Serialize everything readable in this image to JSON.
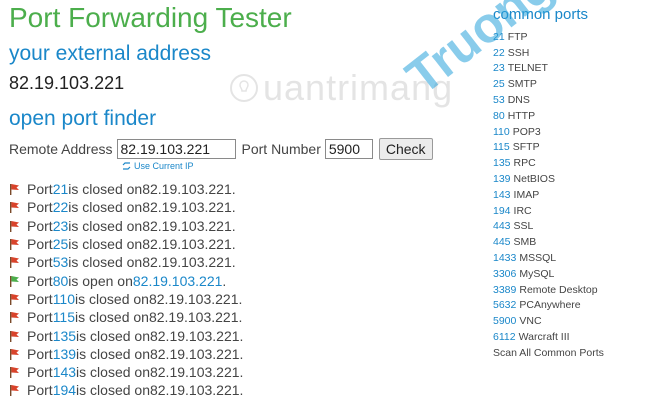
{
  "title": "Port Forwarding Tester",
  "external_heading": "your external address",
  "external_ip": "82.19.103.221",
  "finder_heading": "open port finder",
  "form": {
    "remote_label": "Remote Address",
    "remote_value": "82.19.103.221",
    "port_label": "Port Number",
    "port_value": "5900",
    "check_label": "Check",
    "use_current": "Use Current IP"
  },
  "results": [
    {
      "status": "closed",
      "pre": "Port ",
      "port": "21",
      "mid": " is closed on ",
      "ip": "82.19.103.221",
      "post": "."
    },
    {
      "status": "closed",
      "pre": "Port ",
      "port": "22",
      "mid": " is closed on ",
      "ip": "82.19.103.221",
      "post": "."
    },
    {
      "status": "closed",
      "pre": "Port ",
      "port": "23",
      "mid": " is closed on ",
      "ip": "82.19.103.221",
      "post": "."
    },
    {
      "status": "closed",
      "pre": "Port ",
      "port": "25",
      "mid": " is closed on ",
      "ip": "82.19.103.221",
      "post": "."
    },
    {
      "status": "closed",
      "pre": "Port ",
      "port": "53",
      "mid": " is closed on ",
      "ip": "82.19.103.221",
      "post": "."
    },
    {
      "status": "open",
      "pre": "Port ",
      "port": "80",
      "mid": " is open on ",
      "ip": "82.19.103.221",
      "post": "."
    },
    {
      "status": "closed",
      "pre": "Port ",
      "port": "110",
      "mid": " is closed on ",
      "ip": "82.19.103.221",
      "post": "."
    },
    {
      "status": "closed",
      "pre": "Port ",
      "port": "115",
      "mid": " is closed on ",
      "ip": "82.19.103.221",
      "post": "."
    },
    {
      "status": "closed",
      "pre": "Port ",
      "port": "135",
      "mid": " is closed on ",
      "ip": "82.19.103.221",
      "post": "."
    },
    {
      "status": "closed",
      "pre": "Port ",
      "port": "139",
      "mid": " is closed on ",
      "ip": "82.19.103.221",
      "post": "."
    },
    {
      "status": "closed",
      "pre": "Port ",
      "port": "143",
      "mid": " is closed on ",
      "ip": "82.19.103.221",
      "post": "."
    },
    {
      "status": "closed",
      "pre": "Port ",
      "port": "194",
      "mid": " is closed on ",
      "ip": "82.19.103.221",
      "post": "."
    }
  ],
  "sidebar": {
    "heading": "common ports",
    "ports": [
      {
        "num": "21",
        "name": "FTP"
      },
      {
        "num": "22",
        "name": "SSH"
      },
      {
        "num": "23",
        "name": "TELNET"
      },
      {
        "num": "25",
        "name": "SMTP"
      },
      {
        "num": "53",
        "name": "DNS"
      },
      {
        "num": "80",
        "name": "HTTP"
      },
      {
        "num": "110",
        "name": "POP3"
      },
      {
        "num": "115",
        "name": "SFTP"
      },
      {
        "num": "135",
        "name": "RPC"
      },
      {
        "num": "139",
        "name": "NetBIOS"
      },
      {
        "num": "143",
        "name": "IMAP"
      },
      {
        "num": "194",
        "name": "IRC"
      },
      {
        "num": "443",
        "name": "SSL"
      },
      {
        "num": "445",
        "name": "SMB"
      },
      {
        "num": "1433",
        "name": "MSSQL"
      },
      {
        "num": "3306",
        "name": "MySQL"
      },
      {
        "num": "3389",
        "name": "Remote Desktop"
      },
      {
        "num": "5632",
        "name": "PCAnywhere"
      },
      {
        "num": "5900",
        "name": "VNC"
      },
      {
        "num": "6112",
        "name": "Warcraft III"
      }
    ],
    "scan_all": "Scan All Common Ports"
  },
  "watermarks": {
    "logo_text": "uantrimang",
    "diagonal_text": "Truongthin.top"
  },
  "colors": {
    "title_green": "#4cae4c",
    "link_blue": "#1a87c9",
    "closed_flag": "#d9432b",
    "open_flag": "#4cae4c"
  },
  "icons": {
    "closed": "red-flag-icon",
    "open": "green-flag-icon",
    "use_current": "refresh-icon"
  }
}
